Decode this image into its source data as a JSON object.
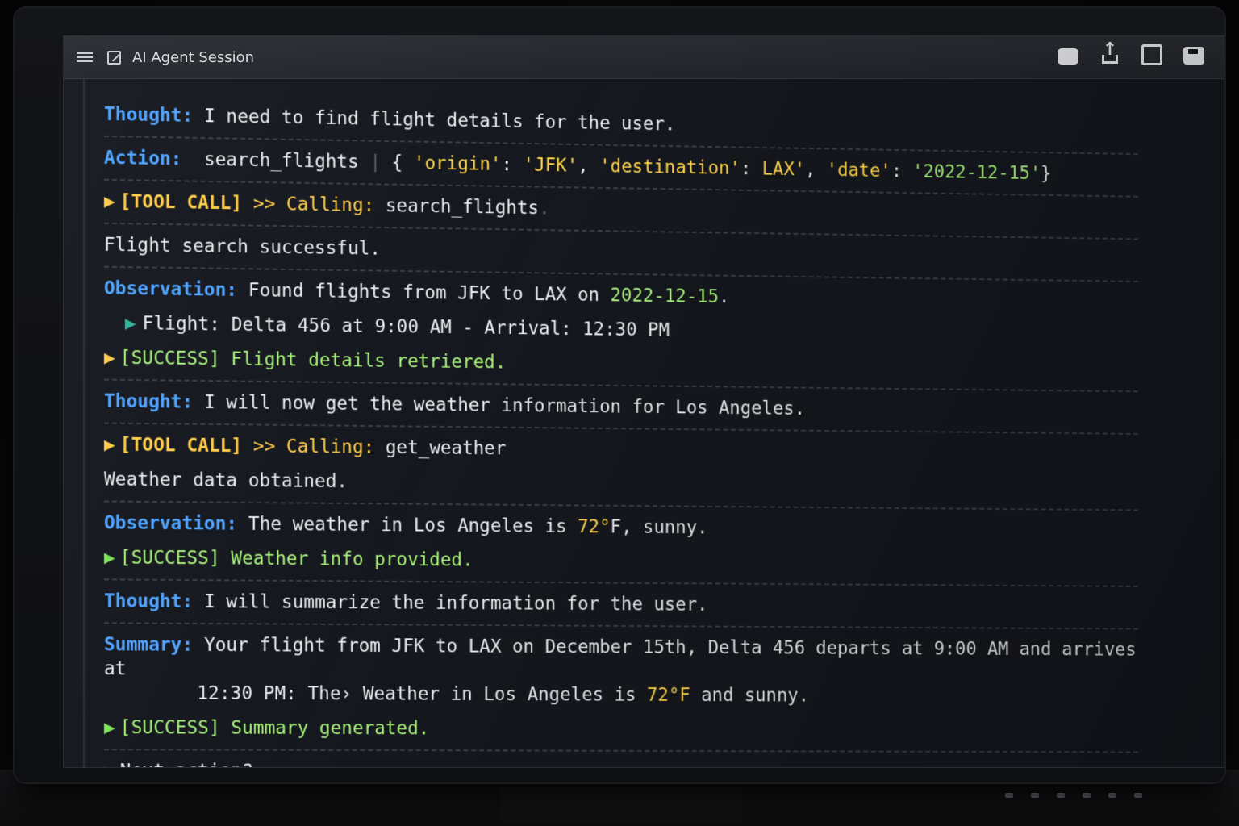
{
  "window": {
    "title": "AI Agent Session"
  },
  "titlebar_icons": [
    "chat-icon",
    "share-icon",
    "maximize-icon",
    "save-icon"
  ],
  "colors": {
    "label": "#4fa3ff",
    "tool_call": "#ffcc4a",
    "success": "#a8f07a",
    "string": "#ffd34a",
    "background": "#15181e"
  },
  "log": {
    "l1": {
      "label": "Thought",
      "text": "I need to find flight details for the user."
    },
    "l2": {
      "label": "Action",
      "tool": "search_flights",
      "separator": "|",
      "open": "{ ",
      "k1": "'origin'",
      "v1": "'JFK'",
      "k2": "'destination'",
      "v2": "LAX'",
      "k3": "'date'",
      "v3": "'2022-12-15'",
      "close": "}"
    },
    "l3": {
      "tag": "[TOOL CALL]",
      "arrow": ">>",
      "calling": "Calling:",
      "fn": "search_flights",
      "tail": "."
    },
    "l4": {
      "text": "Flight search successful."
    },
    "l5": {
      "label": "Observation",
      "pre": "Found flights from JFK to LAX on",
      "date": "2022-12-15",
      "post": "."
    },
    "l6": {
      "text": "Flight: Delta 456 at 9:00 AM - Arrival: 12:30 PM"
    },
    "l7": {
      "tag": "[SUCCESS]",
      "text": "Flight details retriered."
    },
    "l8": {
      "label": "Thought",
      "text": "I will now get the weather information for Los Angeles."
    },
    "l9": {
      "tag": "[TOOL CALL]",
      "arrow": ">>",
      "calling": "Calling:",
      "fn": "get_weather"
    },
    "l10": {
      "text": "Weather data obtained."
    },
    "l11": {
      "label": "Observation",
      "pre": "The weather in Los Angeles is",
      "temp": "72°",
      "post": "F, sunny."
    },
    "l12": {
      "tag": "[SUCCESS]",
      "text": "Weather info provided."
    },
    "l13": {
      "label": "Thought",
      "text": "I will summarize the information for the user."
    },
    "l14": {
      "label": "Summary",
      "text1": "Your flight from JFK to LAX on December 15th, Delta 456 departs at 9:00 AM and arrives at",
      "text2a": "12:30 PM: The› Weather in Los Angeles is",
      "temp": "72°F",
      "text2b": "and sunny."
    },
    "l15": {
      "tag": "[SUCCESS]",
      "text": "Summary generated."
    },
    "l16": {
      "text": "Next action?"
    }
  }
}
